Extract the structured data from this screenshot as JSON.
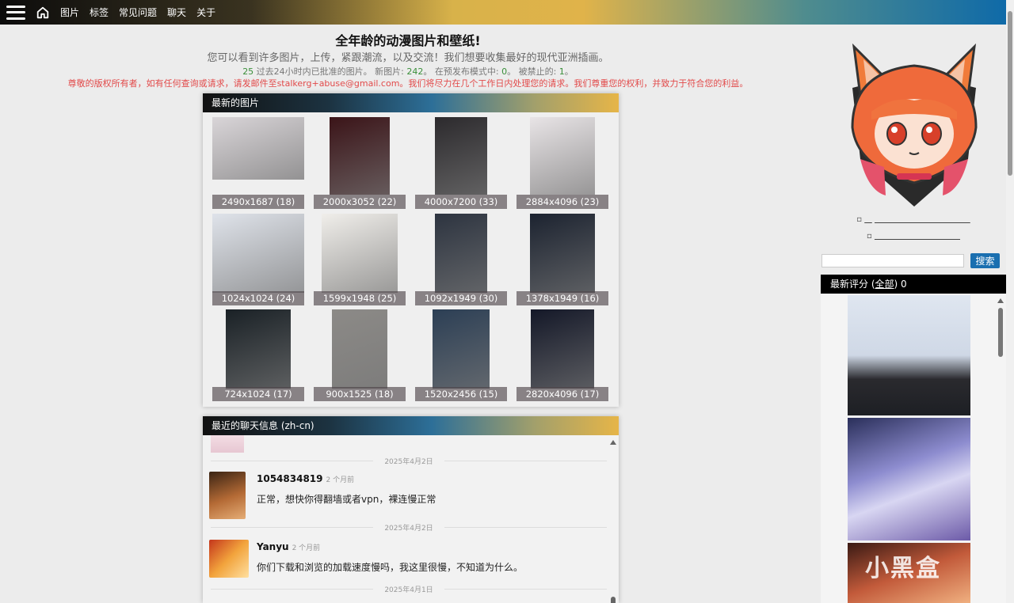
{
  "nav": {
    "items": [
      "图片",
      "标签",
      "常见问题",
      "聊天",
      "关于"
    ]
  },
  "header": {
    "title": "全年龄的动漫图片和壁纸!",
    "subtitle": "您可以看到许多图片，上传，紧跟潮流，以及交流！我们想要收集最好的现代亚洲插画。",
    "stats": {
      "count24": "25",
      "text1": " 过去24小时内已批准的图片。 新图片: ",
      "new_images": "242",
      "text2": "。 在预发布模式中: ",
      "prerelease": "0",
      "text3": "。 被禁止的: ",
      "banned": "1",
      "text4": "。"
    },
    "copyright": "尊敬的版权所有者，如有任何查询或请求，请发邮件至stalkerg+abuse@gmail.com。我们将尽力在几个工作日内处理您的请求。我们尊重您的权利，并致力于符合您的利益。"
  },
  "gallery": {
    "title": "最新的图片",
    "images": [
      {
        "caption": "2490x1687 (18)",
        "color": "#d9d5d8"
      },
      {
        "caption": "2000x3052 (22)",
        "color": "#3b1418"
      },
      {
        "caption": "4000x7200 (33)",
        "color": "#2c2a2d"
      },
      {
        "caption": "2884x4096 (23)",
        "color": "#e8e4e6"
      },
      {
        "caption": "1024x1024 (24)",
        "color": "#dfe3ea"
      },
      {
        "caption": "1599x1948 (25)",
        "color": "#f0eeea"
      },
      {
        "caption": "1092x1949 (30)",
        "color": "#2d3440"
      },
      {
        "caption": "1378x1949 (16)",
        "color": "#1c2330"
      },
      {
        "caption": "724x1024 (17)",
        "color": "#1a2126"
      },
      {
        "caption": "900x1525 (18)",
        "color": "#8c8a87"
      },
      {
        "caption": "1520x2456 (15)",
        "color": "#2c3f55"
      },
      {
        "caption": "2820x4096 (17)",
        "color": "#141828"
      }
    ]
  },
  "chat": {
    "title": "最近的聊天信息 (zh-cn)",
    "messages": [
      {
        "date": "2025年4月2日",
        "user": "1054834819",
        "time": "2 个月前",
        "text": "正常，想快你得翻墙或者vpn，裸连慢正常"
      },
      {
        "date": "2025年4月2日",
        "user": "Yanyu",
        "time": "2 个月前",
        "text": "你们下载和浏览的加载速度慢吗，我这里很慢，不知道为什么。"
      },
      {
        "date": "2025年4月1日"
      }
    ]
  },
  "sidebar": {
    "search_button": "搜索",
    "search_value": "",
    "ratings_label": "最新评分 (",
    "ratings_all": "全部",
    "ratings_tail": ") 0",
    "watermark": "小黑盒"
  }
}
